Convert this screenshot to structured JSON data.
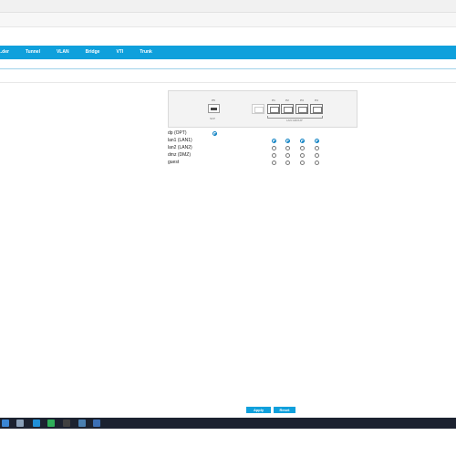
{
  "nav": {
    "items": [
      "...der",
      "Tunnel",
      "VLAN",
      "Bridge",
      "VTI",
      "Trunk"
    ]
  },
  "device": {
    "port_labels": [
      "P5",
      "P1",
      "P2",
      "P3",
      "P4"
    ],
    "sfp_caption": "SFP",
    "lan_group_caption": "LAN GROUP"
  },
  "rows": [
    {
      "label": "dp (OPT)",
      "radios": [
        true,
        null,
        null,
        null,
        null
      ]
    },
    {
      "label": "lan1 (LAN1)",
      "radios": [
        null,
        true,
        true,
        true,
        true
      ]
    },
    {
      "label": "lan2 (LAN2)",
      "radios": [
        null,
        false,
        false,
        false,
        false
      ]
    },
    {
      "label": "dmz (DMZ)",
      "radios": [
        null,
        false,
        false,
        false,
        false
      ]
    },
    {
      "label": "guest",
      "radios": [
        null,
        false,
        false,
        false,
        false
      ]
    }
  ],
  "buttons": {
    "apply": "Apply",
    "reset": "Reset"
  },
  "colors": {
    "accent": "#0fa0dc",
    "taskbar": "#1c2230"
  }
}
